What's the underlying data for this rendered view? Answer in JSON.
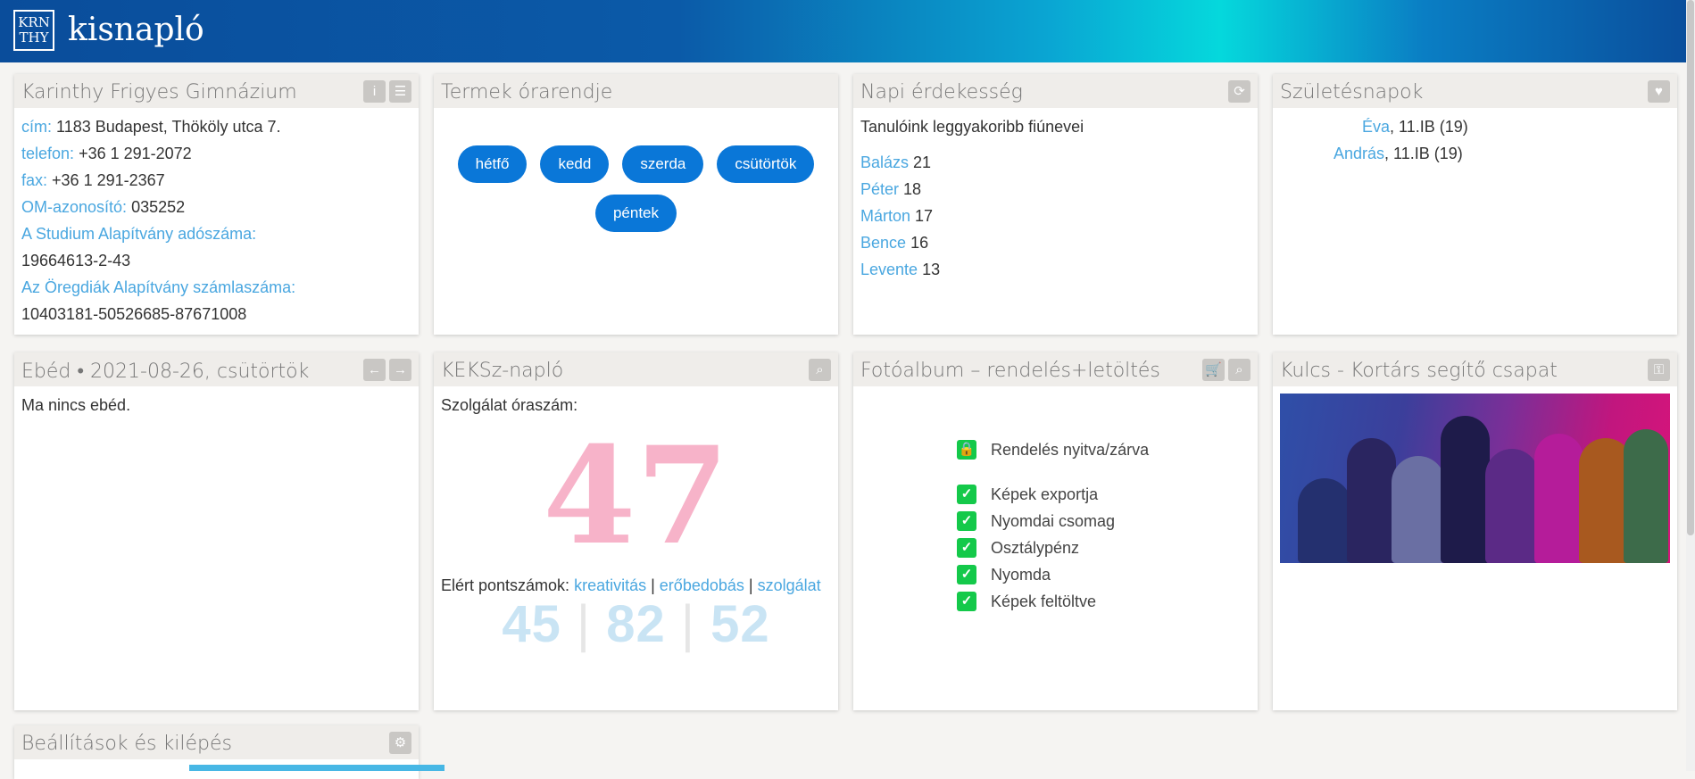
{
  "header": {
    "logo_line1": "KRN",
    "logo_line2": "THY",
    "brand": "kisnapló"
  },
  "school": {
    "title": "Karinthy Frigyes Gimnázium",
    "rows": [
      {
        "label": "cím:",
        "value": "1183 Budapest, Thököly utca 7."
      },
      {
        "label": "telefon:",
        "value": "+36 1 291-2072"
      },
      {
        "label": "fax:",
        "value": "+36 1 291-2367"
      },
      {
        "label": "OM-azonosító:",
        "value": "035252"
      }
    ],
    "studium_label": "A Studium Alapítvány adószáma:",
    "studium_value": "19664613-2-43",
    "oregdiak_label": "Az Öregdiák Alapítvány számlaszáma:",
    "oregdiak_value": "10403181-50526685-87671008"
  },
  "rooms": {
    "title": "Termek órarendje",
    "days": [
      "hétfő",
      "kedd",
      "szerda",
      "csütörtök",
      "péntek"
    ]
  },
  "daily": {
    "title": "Napi érdekesség",
    "intro": "Tanulóink leggyakoribb fiúnevei",
    "names": [
      {
        "name": "Balázs",
        "count": "21"
      },
      {
        "name": "Péter",
        "count": "18"
      },
      {
        "name": "Márton",
        "count": "17"
      },
      {
        "name": "Bence",
        "count": "16"
      },
      {
        "name": "Levente",
        "count": "13"
      }
    ]
  },
  "birthdays": {
    "title": "Születésnapok",
    "items": [
      {
        "name": "Éva",
        "class": ", 11.IB (19)"
      },
      {
        "name": "András",
        "class": ", 11.IB (19)"
      }
    ]
  },
  "lunch": {
    "title": "Ebéd • 2021-08-26, csütörtök",
    "text": "Ma nincs ebéd."
  },
  "keksz": {
    "title": "KEKSz-napló",
    "hours_label": "Szolgálat óraszám:",
    "hours": "47",
    "points_label": "Elért pontszámok:",
    "cat1": "kreativitás",
    "cat2": "erőbedobás",
    "cat3": "szolgálat",
    "sep": " | ",
    "s1": "45",
    "s2": "82",
    "s3": "52"
  },
  "photo_album": {
    "title": "Fotóalbum – rendelés+letöltés",
    "order": "Rendelés nyitva/zárva",
    "items": [
      "Képek exportja",
      "Nyomdai csomag",
      "Osztálypénz",
      "Nyomda",
      "Képek feltöltve"
    ]
  },
  "kulcs": {
    "title": "Kulcs - Kortárs segítő csapat"
  },
  "settings": {
    "title": "Beállítások és kilépés"
  },
  "colors": {
    "accent": "#0a77d8",
    "label": "#4aa7e0",
    "check": "#14c94a",
    "big_number": "#f7b3c9"
  }
}
